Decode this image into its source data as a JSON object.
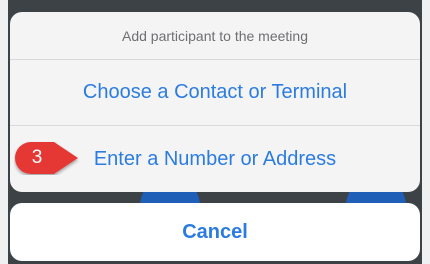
{
  "action_sheet": {
    "title": "Add participant to the meeting",
    "options": [
      {
        "label": "Choose a Contact or Terminal"
      },
      {
        "label": "Enter a Number or Address"
      }
    ],
    "cancel_label": "Cancel"
  },
  "annotation": {
    "step_number": "3",
    "color": "#e53935"
  },
  "colors": {
    "accent": "#2c7ce0",
    "title_text": "#6f6f72",
    "sheet_bg": "#f4f4f5",
    "cancel_bg": "#ffffff"
  }
}
